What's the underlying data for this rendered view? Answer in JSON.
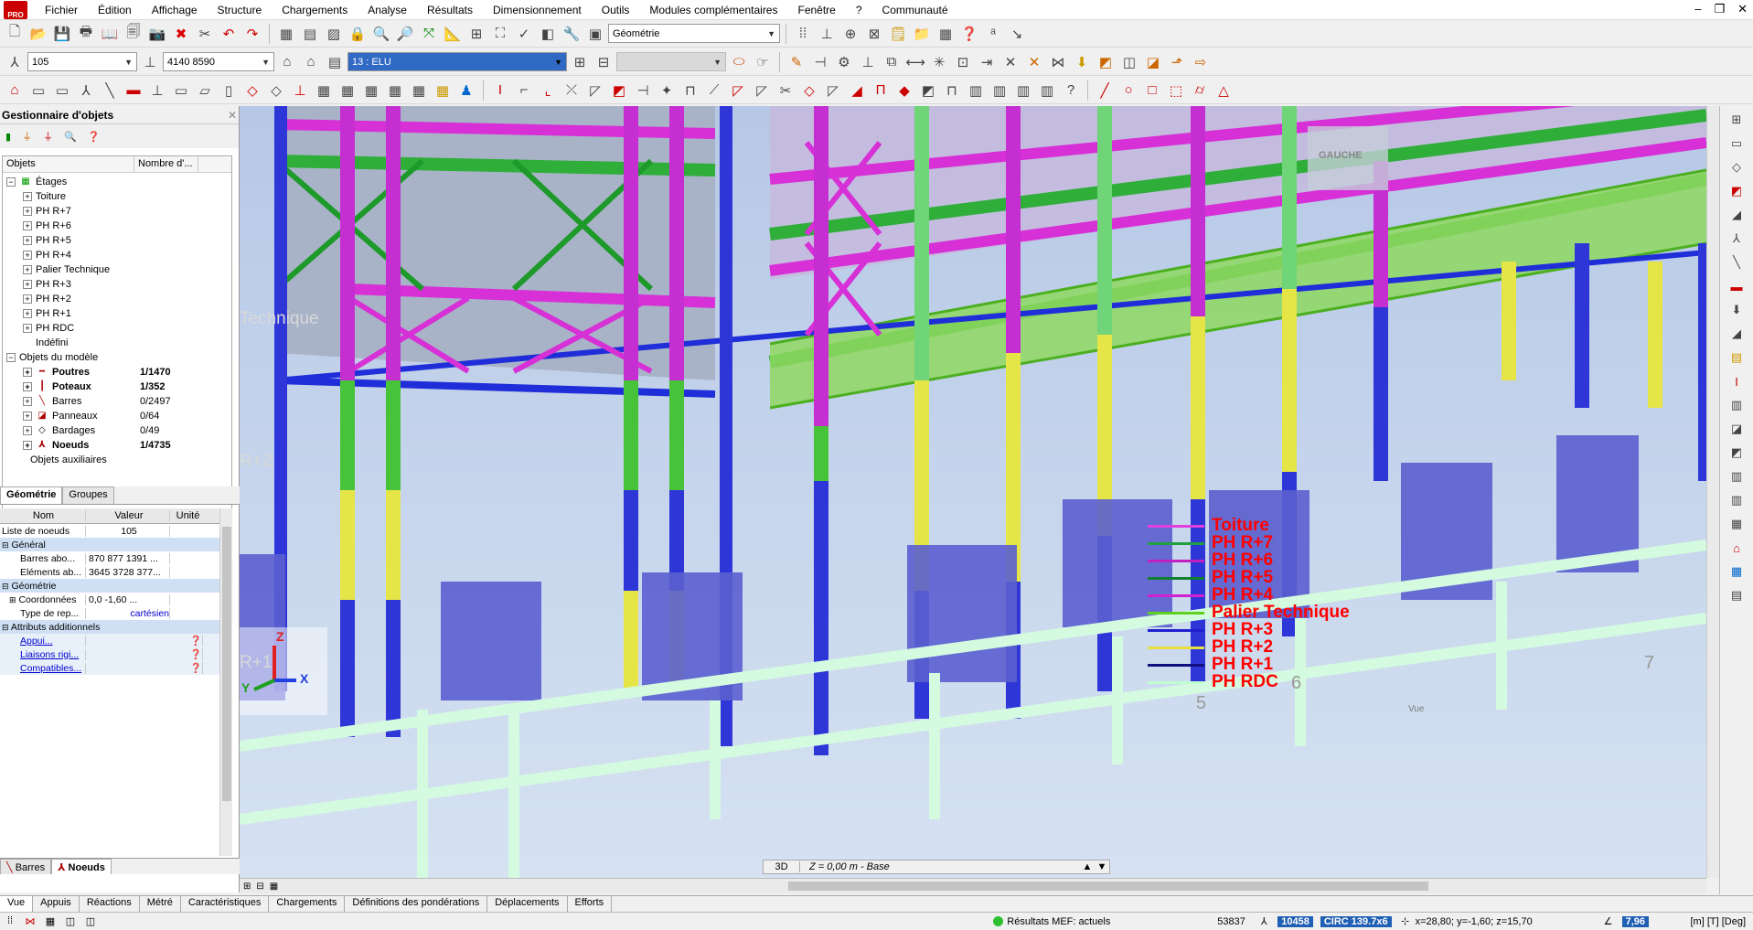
{
  "app": {
    "logo_text": "PRO"
  },
  "menu": [
    "Fichier",
    "Édition",
    "Affichage",
    "Structure",
    "Chargements",
    "Analyse",
    "Résultats",
    "Dimensionnement",
    "Outils",
    "Modules complémentaires",
    "Fenêtre",
    "?",
    "Communauté"
  ],
  "toolbar": {
    "node_combo": "105",
    "node_list_combo": "4140 8590",
    "load_combo": "13 : ELU",
    "layout_combo": "Géométrie"
  },
  "object_manager": {
    "title": "Gestionnaire d'objets",
    "col_objects": "Objets",
    "col_count": "Nombre d'...",
    "floors_label": "Étages",
    "floors": [
      "Toiture",
      "PH R+7",
      "PH R+6",
      "PH R+5",
      "PH R+4",
      "Palier Technique",
      "PH R+3",
      "PH R+2",
      "PH R+1",
      "PH RDC",
      "Indéfini"
    ],
    "model_objects_label": "Objets du modèle",
    "model_objects": [
      {
        "name": "Poutres",
        "count": "1/1470",
        "bold": true
      },
      {
        "name": "Poteaux",
        "count": "1/352",
        "bold": true
      },
      {
        "name": "Barres",
        "count": "0/2497",
        "bold": false
      },
      {
        "name": "Panneaux",
        "count": "0/64",
        "bold": false
      },
      {
        "name": "Bardages",
        "count": "0/49",
        "bold": false
      },
      {
        "name": "Noeuds",
        "count": "1/4735",
        "bold": true
      }
    ],
    "aux_label": "Objets auxiliaires"
  },
  "panel_tabs": [
    "Géométrie",
    "Groupes"
  ],
  "properties": {
    "headers": [
      "Nom",
      "Valeur",
      "Unité"
    ],
    "node_list_label": "Liste de noeuds",
    "node_list_value": "105",
    "general_label": "Général",
    "bars_label": "Barres abo...",
    "bars_value": "870 877 1391 ...",
    "elements_label": "Eléments ab...",
    "elements_value": "3645 3728 377...",
    "geometry_label": "Géométrie",
    "coords_label": "Coordonnées",
    "coords_value": "0,0     -1,60 ...",
    "ref_type_label": "Type de rep...",
    "ref_type_value": "cartésien",
    "additional_label": "Attributs additionnels",
    "support_label": "Appui...",
    "rigid_label": "Liaisons rigi...",
    "compat_label": "Compatibles..."
  },
  "bottom_tabs": [
    "Barres",
    "Noeuds"
  ],
  "view_tabs": [
    "Vue",
    "Appuis",
    "Réactions",
    "Métré",
    "Caractéristiques",
    "Chargements",
    "Définitions des pondérations",
    "Déplacements",
    "Efforts"
  ],
  "viewport": {
    "view_mode": "3D",
    "elevation": "Z = 0,00 m - Base",
    "view_caption": "Vue",
    "cube_label": "GAUCHE",
    "axis_x": "X",
    "axis_y": "Y",
    "axis_z": "Z",
    "side_labels": [
      "Technique",
      "R+2",
      "R+1"
    ],
    "grid_numbers": [
      "5",
      "6",
      "7"
    ]
  },
  "legend": [
    {
      "label": "Toiture",
      "color": "#e040e0"
    },
    {
      "label": "PH R+7",
      "color": "#20a040"
    },
    {
      "label": "PH R+6",
      "color": "#c020c0"
    },
    {
      "label": "PH R+5",
      "color": "#108030"
    },
    {
      "label": "PH R+4",
      "color": "#d020d0"
    },
    {
      "label": "Palier Technique",
      "color": "#60d020"
    },
    {
      "label": "PH R+3",
      "color": "#2020d0"
    },
    {
      "label": "PH R+2",
      "color": "#e8e040"
    },
    {
      "label": "PH R+1",
      "color": "#101080"
    },
    {
      "label": "PH RDC",
      "color": "#c0ffd0"
    }
  ],
  "status": {
    "results": "Résultats MEF: actuels",
    "num1": "53837",
    "num2": "10458",
    "circ": "CIRC 139.7x6",
    "coords": "x=28,80; y=-1,60; z=15,70",
    "angle": "7,96",
    "units": "[m] [T] [Deg]"
  }
}
